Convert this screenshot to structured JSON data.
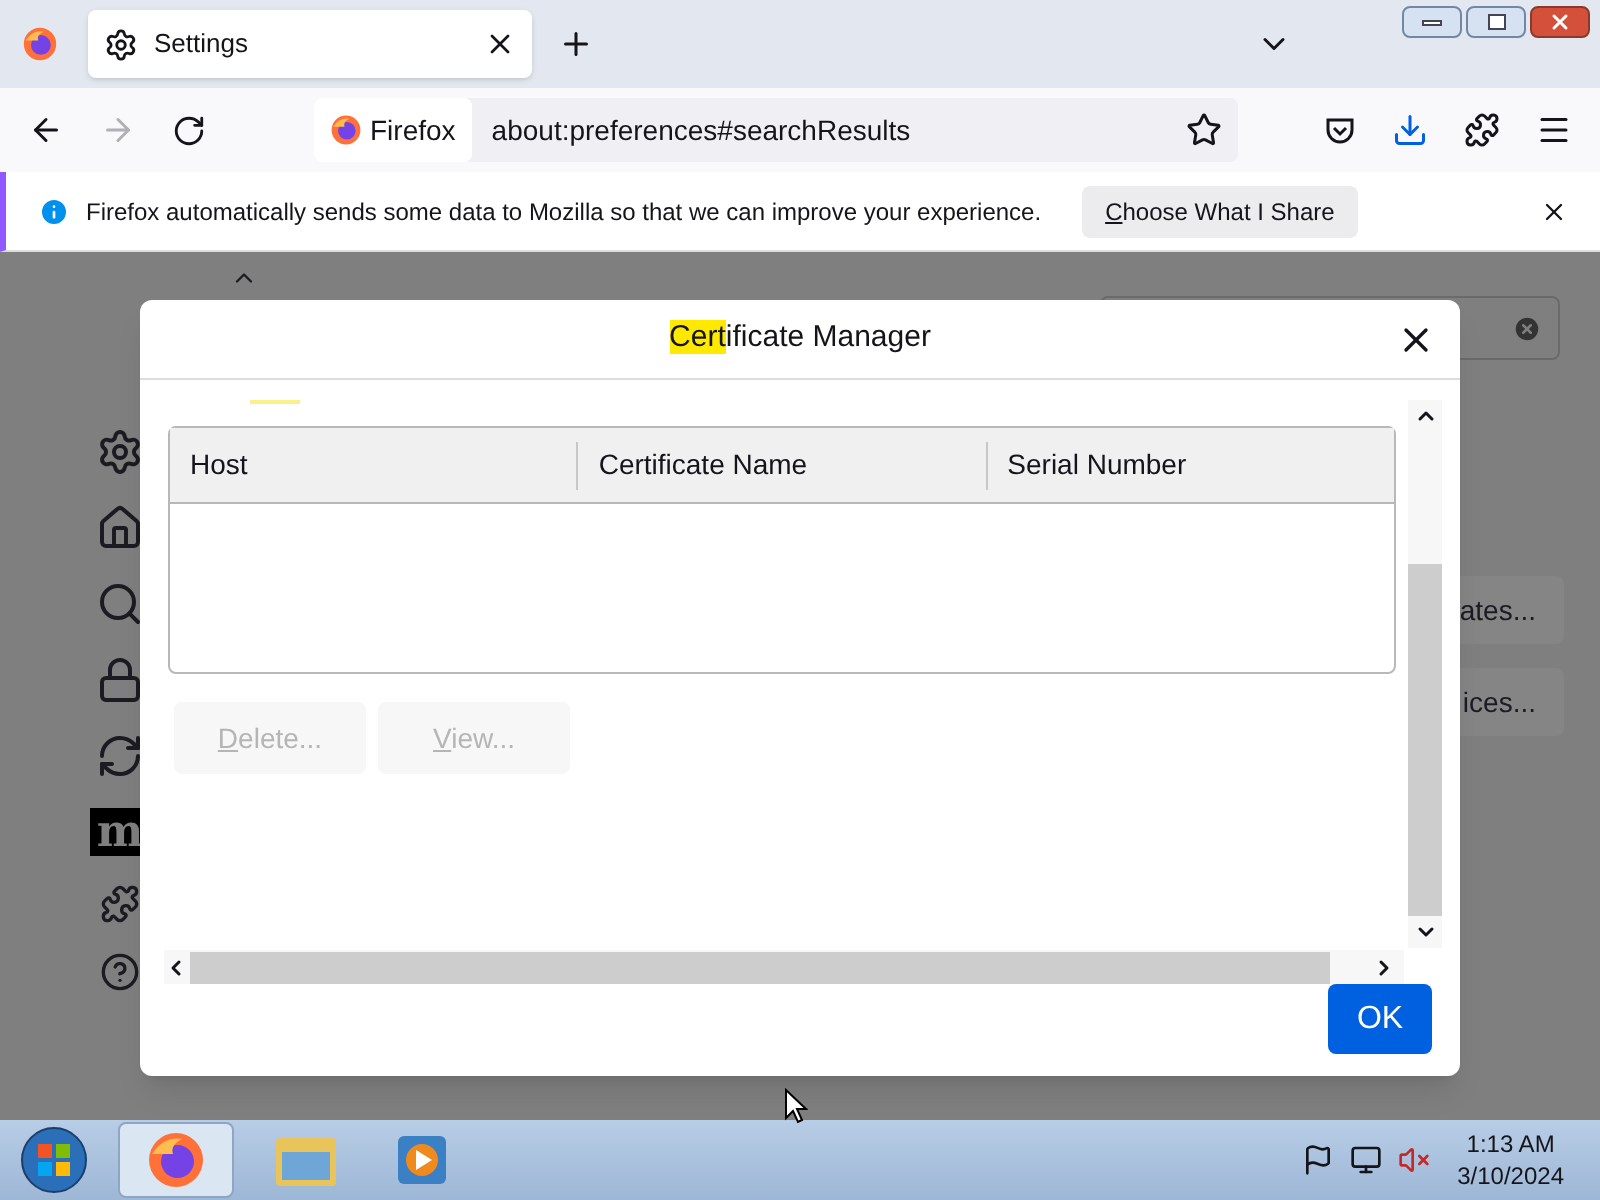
{
  "tabs": [
    {
      "title": "Settings",
      "selected": true
    }
  ],
  "urlbar": {
    "identity": "Firefox",
    "url": "about:preferences#searchResults"
  },
  "notification": {
    "message": "Firefox automatically sends some data to Mozilla so that we can improve your experience.",
    "button": "Choose What I Share"
  },
  "sidebar": {
    "logo": "m"
  },
  "background_buttons": [
    "ates...",
    "ices..."
  ],
  "dialog": {
    "title_match": "Cert",
    "title_rest": "ificate Manager",
    "table": {
      "columns": [
        "Host",
        "Certificate Name",
        "Serial Number"
      ]
    },
    "buttons": [
      {
        "label": "Delete...",
        "disabled": true
      },
      {
        "label": "View...",
        "disabled": true
      }
    ],
    "ok": "OK"
  },
  "taskbar": {
    "time": "1:13 AM",
    "date": "3/10/2024"
  }
}
